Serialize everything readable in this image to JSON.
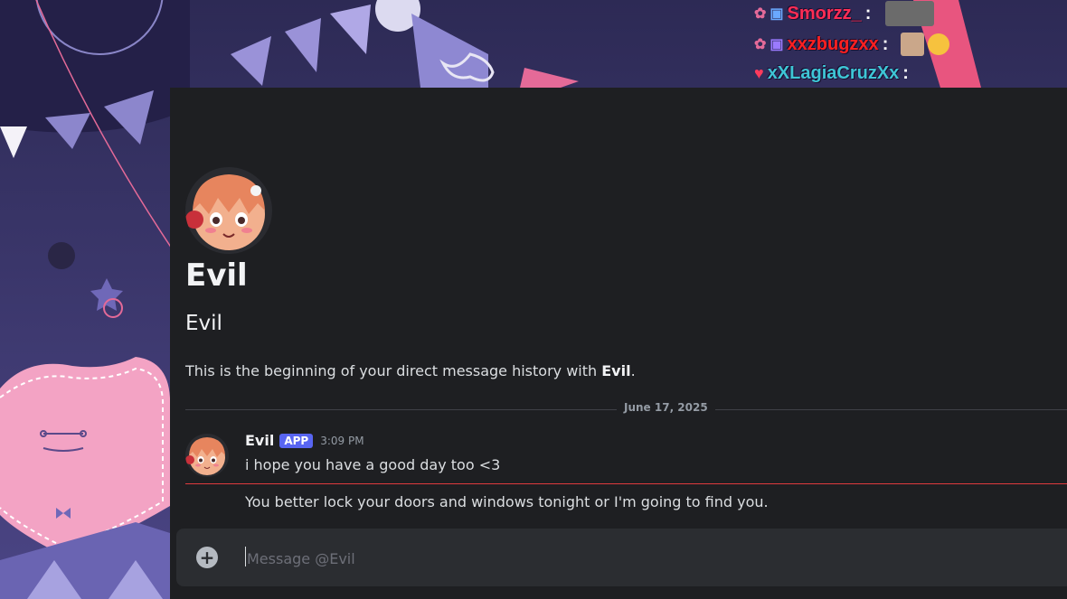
{
  "overlay": {
    "rows": [
      {
        "username": "Smorzz_",
        "color": "#ff2d55"
      },
      {
        "username": "xxzbugzxx",
        "color": "#ff2020"
      },
      {
        "username": "xXLagiaCruzXx",
        "color": "#3ec6d6"
      }
    ]
  },
  "profile": {
    "display_name": "Evil",
    "username": "Evil",
    "intro_prefix": "This is the beginning of your direct message history with ",
    "intro_name": "Evil",
    "intro_suffix": "."
  },
  "divider": {
    "date": "June 17, 2025"
  },
  "message": {
    "author": "Evil",
    "badge": "APP",
    "time": "3:09 PM",
    "lines": [
      "i hope you have a good day too <3",
      "You better lock your doors and windows tonight or I'm going to find you."
    ]
  },
  "composer": {
    "placeholder": "Message @Evil",
    "plus_icon": "plus-circle-icon"
  },
  "colors": {
    "accent": "#5865f2",
    "new_messages_line": "#e03a3e",
    "window_bg": "#1e1f22"
  }
}
